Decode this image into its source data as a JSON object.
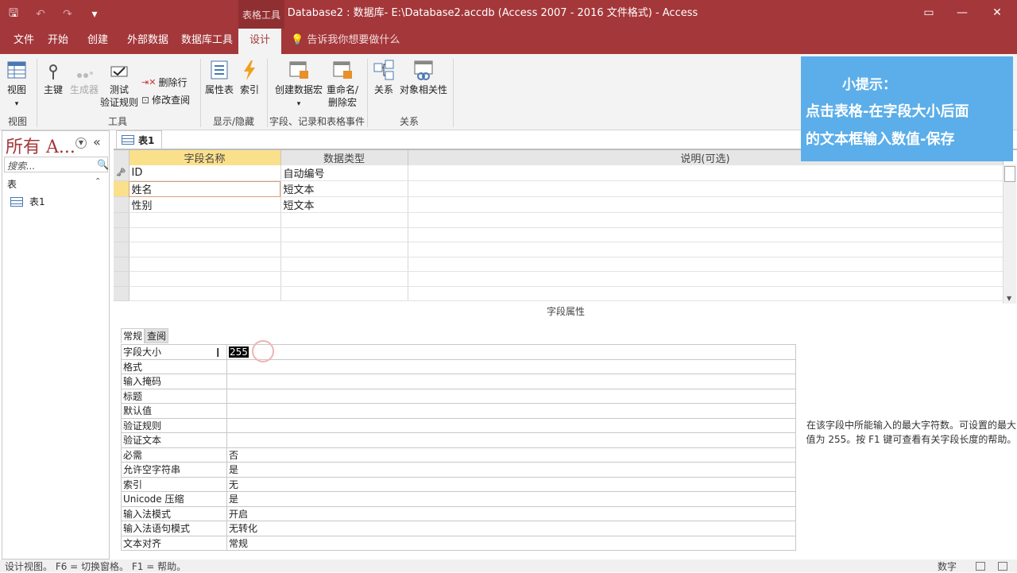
{
  "title": "Database2 : 数据库- E:\\Database2.accdb (Access 2007 - 2016 文件格式)  -  Access",
  "context_tab": "表格工具",
  "ribbon_tabs": [
    "文件",
    "开始",
    "创建",
    "外部数据",
    "数据库工具",
    "设计"
  ],
  "tell_me": "告诉我你想要做什么",
  "ribbon": {
    "view": "视图",
    "primary_key": "主键",
    "builder": "生成器",
    "test_rules_1": "测试",
    "test_rules_2": "验证规则",
    "delete_rows": "删除行",
    "modify_lookup": "修改查阅",
    "property_sheet": "属性表",
    "indexes": "索引",
    "create_macro": "创建数据宏",
    "rename_macro_1": "重命名/",
    "rename_macro_2": "删除宏",
    "relationships": "关系",
    "dependencies": "对象相关性",
    "groups": [
      "视图",
      "工具",
      "显示/隐藏",
      "字段、记录和表格事件",
      "关系"
    ]
  },
  "tip": {
    "line1": "小提示：",
    "line2": "点击表格-在字段大小后面",
    "line3": "的文本框输入数值-保存"
  },
  "nav": {
    "header": "所有 A...",
    "search_placeholder": "搜索...",
    "section": "表",
    "items": [
      "表1"
    ]
  },
  "doc_tab": "表1",
  "grid": {
    "headers": [
      "字段名称",
      "数据类型",
      "说明(可选)"
    ],
    "rows": [
      {
        "name": "ID",
        "type": "自动编号",
        "desc": ""
      },
      {
        "name": "姓名",
        "type": "短文本",
        "desc": ""
      },
      {
        "name": "性别",
        "type": "短文本",
        "desc": ""
      }
    ]
  },
  "field_props_title": "字段属性",
  "props_tabs": [
    "常规",
    "查阅"
  ],
  "properties": [
    {
      "k": "字段大小",
      "v": "255"
    },
    {
      "k": "格式",
      "v": ""
    },
    {
      "k": "输入掩码",
      "v": ""
    },
    {
      "k": "标题",
      "v": ""
    },
    {
      "k": "默认值",
      "v": ""
    },
    {
      "k": "验证规则",
      "v": ""
    },
    {
      "k": "验证文本",
      "v": ""
    },
    {
      "k": "必需",
      "v": "否"
    },
    {
      "k": "允许空字符串",
      "v": "是"
    },
    {
      "k": "索引",
      "v": "无"
    },
    {
      "k": "Unicode 压缩",
      "v": "是"
    },
    {
      "k": "输入法模式",
      "v": "开启"
    },
    {
      "k": "输入法语句模式",
      "v": "无转化"
    },
    {
      "k": "文本对齐",
      "v": "常规"
    }
  ],
  "help_text": "在该字段中所能输入的最大字符数。可设置的最大值为 255。按 F1 键可查看有关字段长度的帮助。",
  "status": {
    "left": "设计视图。   F6 = 切换窗格。   F1 = 帮助。",
    "right": "数字"
  }
}
